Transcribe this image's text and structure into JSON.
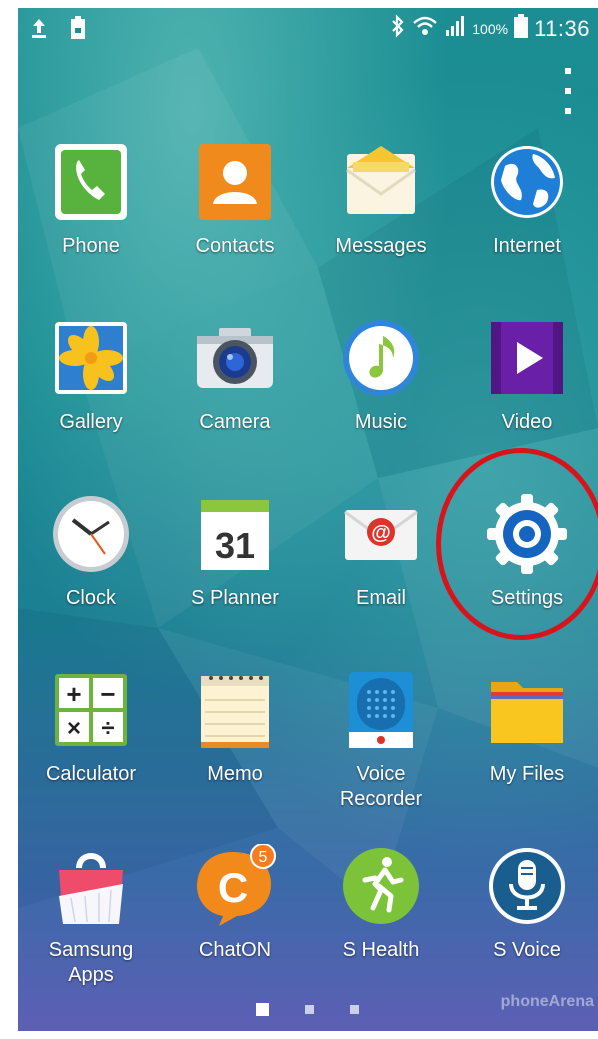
{
  "status_bar": {
    "battery_percent": "100%",
    "time": "11:36",
    "icons": [
      "upload-icon",
      "battery-saver-icon",
      "bluetooth-icon",
      "wifi-icon",
      "signal-icon",
      "battery-icon"
    ]
  },
  "apps": [
    {
      "label": "Phone",
      "icon": "phone-icon"
    },
    {
      "label": "Contacts",
      "icon": "contacts-icon"
    },
    {
      "label": "Messages",
      "icon": "messages-icon"
    },
    {
      "label": "Internet",
      "icon": "internet-icon"
    },
    {
      "label": "Gallery",
      "icon": "gallery-icon"
    },
    {
      "label": "Camera",
      "icon": "camera-icon"
    },
    {
      "label": "Music",
      "icon": "music-icon"
    },
    {
      "label": "Video",
      "icon": "video-icon"
    },
    {
      "label": "Clock",
      "icon": "clock-icon"
    },
    {
      "label": "S Planner",
      "icon": "calendar-icon",
      "icon_text": "31"
    },
    {
      "label": "Email",
      "icon": "email-icon",
      "icon_text": "@"
    },
    {
      "label": "Settings",
      "icon": "settings-gear-icon",
      "highlighted": true
    },
    {
      "label": "Calculator",
      "icon": "calculator-icon",
      "icon_text": [
        "+",
        "−",
        "×",
        "÷"
      ]
    },
    {
      "label": "Memo",
      "icon": "memo-icon"
    },
    {
      "label": "Voice\nRecorder",
      "icon": "voice-recorder-icon"
    },
    {
      "label": "My Files",
      "icon": "folder-icon"
    },
    {
      "label": "Samsung\nApps",
      "icon": "shopping-bag-icon"
    },
    {
      "label": "ChatON",
      "icon": "chat-icon",
      "icon_text": "C",
      "badge": "5"
    },
    {
      "label": "S Health",
      "icon": "runner-icon"
    },
    {
      "label": "S Voice",
      "icon": "microphone-icon"
    }
  ],
  "pager": {
    "pages": 3,
    "active": 1
  },
  "watermark": "phoneArena",
  "colors": {
    "highlight_ring": "#d8131a",
    "settings_blue": "#1565c0",
    "wallpaper": "#168a92"
  }
}
